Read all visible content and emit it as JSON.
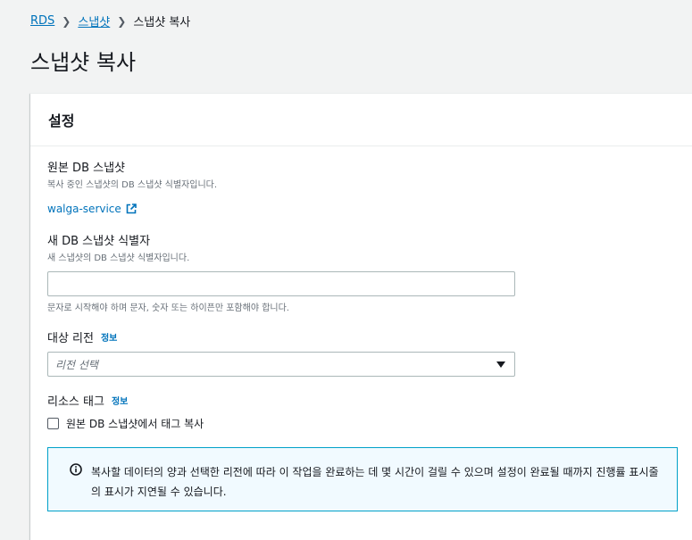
{
  "breadcrumb": {
    "root": "RDS",
    "parent": "스냅샷",
    "current": "스냅샷 복사"
  },
  "page": {
    "title": "스냅샷 복사"
  },
  "panel": {
    "title": "설정"
  },
  "source": {
    "label": "원본 DB 스냅샷",
    "description": "복사 중인 스냅샷의 DB 스냅샷 식별자입니다.",
    "value": "walga-service"
  },
  "new_id": {
    "label": "새 DB 스냅샷 식별자",
    "description": "새 스냅샷의 DB 스냅샷 식별자입니다.",
    "value": "",
    "constraint": "문자로 시작해야 하며 문자, 숫자 또는 하이픈만 포함해야 합니다."
  },
  "region": {
    "label": "대상 리전",
    "info": "정보",
    "placeholder": "리전 선택"
  },
  "tags": {
    "label": "리소스 태그",
    "info": "정보",
    "checkbox_label": "원본 DB 스냅샷에서 태그 복사",
    "checked": false
  },
  "alert": {
    "text": "복사할 데이터의 양과 선택한 리전에 따라 이 작업을 완료하는 데 몇 시간이 걸릴 수 있으며 설정이 완료될 때까지 진행률 표시줄의 표시가 지연될 수 있습니다."
  },
  "colors": {
    "link": "#0073bb",
    "alert_border": "#00a1c9",
    "alert_bg": "#f1faff",
    "background": "#f2f3f3"
  }
}
